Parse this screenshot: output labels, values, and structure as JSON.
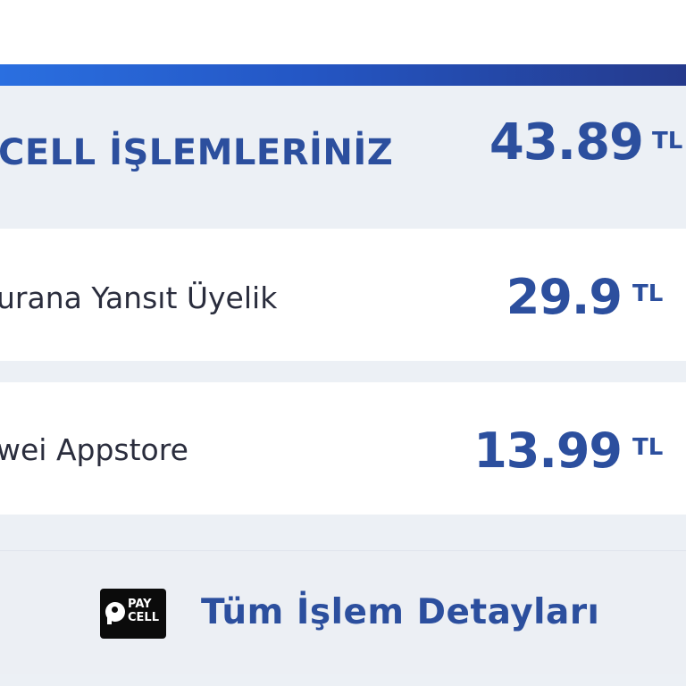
{
  "summary": {
    "title": "CELL İŞLEMLERİNİZ",
    "amount": "43.89",
    "currency": "TL"
  },
  "transactions": [
    {
      "label": "urana Yansıt Üyelik",
      "amount": "29.9",
      "currency": "TL"
    },
    {
      "label": "wei Appstore",
      "amount": "13.99",
      "currency": "TL"
    }
  ],
  "footer": {
    "logo_text": "PAY CELL",
    "logo_icon": "paycell-logo-icon",
    "button_label": "Tüm İşlem Detayları"
  },
  "colors": {
    "accent": "#2c4f9e",
    "bar_start": "#2a6fe0",
    "bar_end": "#253a8c",
    "background": "#ecf0f5"
  }
}
